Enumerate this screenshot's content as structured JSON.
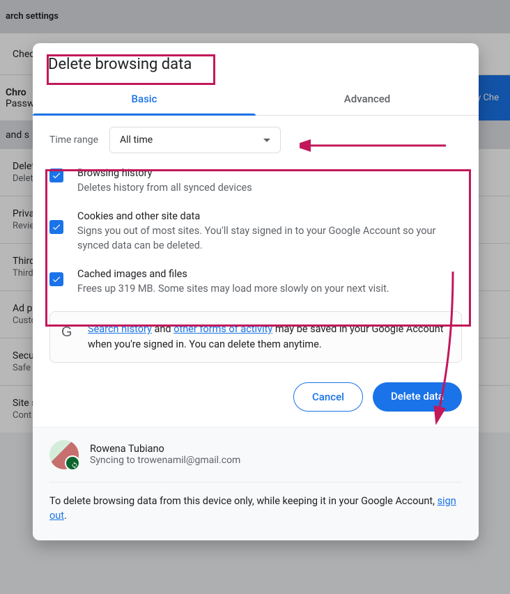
{
  "bg": {
    "search_label": "arch settings",
    "check_label": "Check",
    "section1": {
      "title": "Chro",
      "sub": "Passw"
    },
    "strip": "and s",
    "check_btn": "ty Che",
    "rows": [
      {
        "title": "Delet",
        "sub": "Delet"
      },
      {
        "title": "Priva",
        "sub": "Revie"
      },
      {
        "title": "Third",
        "sub": "Third"
      },
      {
        "title": "Ad p",
        "sub": "Custo"
      },
      {
        "title": "Secu",
        "sub": "Safe"
      },
      {
        "title": "Site s",
        "sub": "Cont"
      }
    ]
  },
  "dialog": {
    "title": "Delete browsing data",
    "tabs": {
      "basic": "Basic",
      "advanced": "Advanced"
    },
    "time": {
      "label": "Time range",
      "value": "All time"
    },
    "items": [
      {
        "title": "Browsing history",
        "sub": "Deletes history from all synced devices"
      },
      {
        "title": "Cookies and other site data",
        "sub": "Signs you out of most sites. You'll stay signed in to your Google Account so your synced data can be deleted."
      },
      {
        "title": "Cached images and files",
        "sub": "Frees up 319 MB. Some sites may load more slowly on your next visit."
      }
    ],
    "info": {
      "link1": "Search history",
      "mid": " and ",
      "link2": "other forms of activity",
      "tail": " may be saved in your Google Account when you're signed in. You can delete them anytime."
    },
    "actions": {
      "cancel": "Cancel",
      "confirm": "Delete data"
    },
    "footer": {
      "user": "Rowena Tubiano",
      "sync": "Syncing to trowenamil@gmail.com",
      "text_pre": "To delete browsing data from this device only, while keeping it in your Google Account, ",
      "signout": "sign out",
      "text_post": "."
    }
  }
}
